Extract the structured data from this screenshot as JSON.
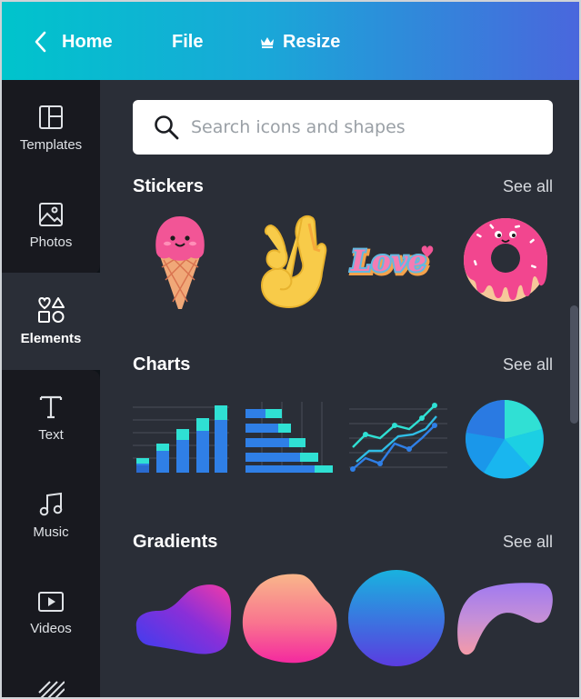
{
  "topbar": {
    "home_label": "Home",
    "file_label": "File",
    "resize_label": "Resize",
    "gradient_start": "#00c4cc",
    "gradient_end": "#4a66dd"
  },
  "sidebar": {
    "items": [
      {
        "label": "Templates",
        "icon": "templates-icon"
      },
      {
        "label": "Photos",
        "icon": "photos-icon"
      },
      {
        "label": "Elements",
        "icon": "elements-icon",
        "active": true
      },
      {
        "label": "Text",
        "icon": "text-icon"
      },
      {
        "label": "Music",
        "icon": "music-icon"
      },
      {
        "label": "Videos",
        "icon": "videos-icon"
      },
      {
        "label": "",
        "icon": "background-pattern-icon"
      }
    ]
  },
  "search": {
    "placeholder": "Search icons and shapes"
  },
  "sections": {
    "stickers": {
      "title": "Stickers",
      "see_all": "See all",
      "items": [
        "ice-cream-sticker",
        "ok-hand-sticker",
        "love-text-sticker",
        "donut-sticker"
      ]
    },
    "charts": {
      "title": "Charts",
      "see_all": "See all",
      "items": [
        "bar-chart-thumb",
        "horizontal-bar-chart-thumb",
        "line-chart-thumb",
        "pie-chart-thumb"
      ]
    },
    "gradients": {
      "title": "Gradients",
      "see_all": "See all",
      "items": [
        "gradient-blob-1",
        "gradient-blob-2",
        "gradient-circle",
        "gradient-blob-3"
      ]
    }
  },
  "colors": {
    "panel_bg": "#2a2e37",
    "sidebar_bg": "#18191f",
    "accent_teal": "#2ee6d6",
    "accent_blue": "#3a8ee6"
  }
}
